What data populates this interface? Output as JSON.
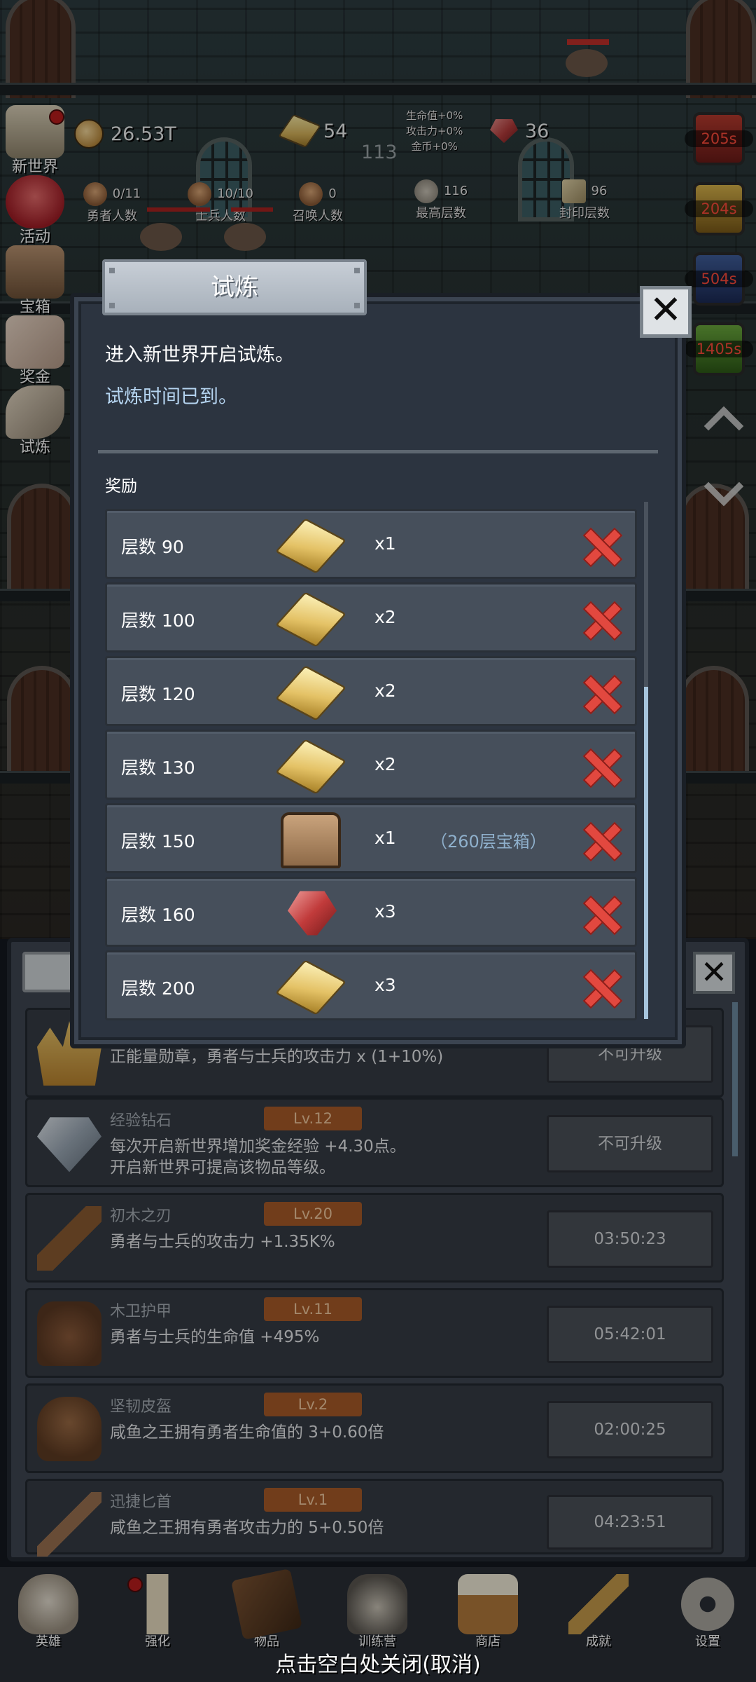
{
  "top_stats": {
    "gold": "26.53T",
    "gold_bars": "54",
    "gems": "36",
    "mid_value": "113",
    "bonus_lines": [
      "生命值+0%",
      "攻击力+0%",
      "金币+0%"
    ]
  },
  "sub_stats": [
    {
      "value": "0/11",
      "label": "勇者人数"
    },
    {
      "value": "10/10",
      "label": "士兵人数"
    },
    {
      "value": "0",
      "label": "召唤人数"
    },
    {
      "value": "116",
      "label": "最高层数"
    },
    {
      "value": "96",
      "label": "封印层数"
    }
  ],
  "left_menu": [
    "新世界",
    "活动",
    "宝箱",
    "奖金",
    "试炼"
  ],
  "buffs": [
    "205s",
    "204s",
    "504s",
    "1405s"
  ],
  "modal": {
    "title": "试炼",
    "intro": "进入新世界开启试炼。",
    "status": "试炼时间已到。",
    "reward_label": "奖励",
    "rewards": [
      {
        "level": "层数 90",
        "icon": "gold-bar",
        "qty": "x1",
        "note": ""
      },
      {
        "level": "层数 100",
        "icon": "gold-bar",
        "qty": "x2",
        "note": ""
      },
      {
        "level": "层数 120",
        "icon": "gold-bar",
        "qty": "x2",
        "note": ""
      },
      {
        "level": "层数 130",
        "icon": "gold-bar",
        "qty": "x2",
        "note": ""
      },
      {
        "level": "层数 150",
        "icon": "chest",
        "qty": "x1",
        "note": "（260层宝箱）"
      },
      {
        "level": "层数 160",
        "icon": "ruby",
        "qty": "x3",
        "note": ""
      },
      {
        "level": "层数 200",
        "icon": "gold-bar",
        "qty": "x3",
        "note": ""
      }
    ]
  },
  "items": [
    {
      "name": "",
      "level": "",
      "desc": "正能量勋章，勇者与士兵的攻击力 x (1+10%)",
      "button": "不可升级",
      "icon": "crown"
    },
    {
      "name": "经验钻石",
      "level": "Lv.12",
      "desc": "每次开启新世界增加奖金经验 +4.30点。",
      "desc2": "开启新世界可提高该物品等级。",
      "button": "不可升级",
      "icon": "diamond"
    },
    {
      "name": "初木之刃",
      "level": "Lv.20",
      "desc": "勇者与士兵的攻击力 +1.35K%",
      "button": "03:50:23",
      "icon": "sword"
    },
    {
      "name": "木卫护甲",
      "level": "Lv.11",
      "desc": "勇者与士兵的生命值 +495%",
      "button": "05:42:01",
      "icon": "armor"
    },
    {
      "name": "坚韧皮盔",
      "level": "Lv.2",
      "desc": "咸鱼之王拥有勇者生命值的 3+0.60倍",
      "button": "02:00:25",
      "icon": "helmet"
    },
    {
      "name": "迅捷匕首",
      "level": "Lv.1",
      "desc": "咸鱼之王拥有勇者攻击力的 5+0.50倍",
      "button": "04:23:51",
      "icon": "dagger"
    }
  ],
  "bottom_nav": [
    "英雄",
    "强化",
    "物品",
    "训练营",
    "商店",
    "成就",
    "设置"
  ],
  "close_hint": "点击空白处关闭(取消)"
}
